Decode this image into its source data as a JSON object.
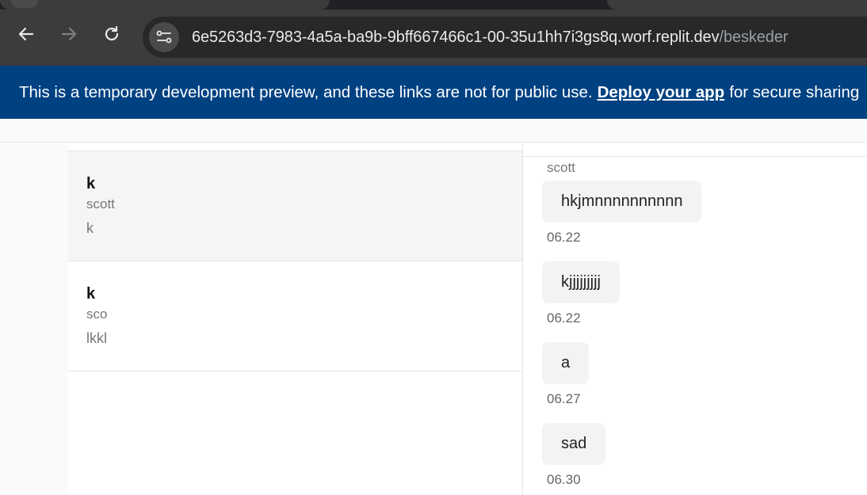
{
  "browser": {
    "url_host": "6e5263d3-7983-4a5a-ba9b-9bff667466c1-00-35u1hh7i3gs8q.worf.replit.dev",
    "url_path": "/beskeder",
    "icons": [
      "back-arrow-icon",
      "forward-arrow-icon",
      "reload-icon",
      "site-settings-icon"
    ]
  },
  "banner": {
    "text_before": "This is a temporary development preview, and these links are not for public use.",
    "link": "Deploy your app",
    "text_after": "for secure sharing"
  },
  "conversations": [
    {
      "title": "k",
      "user": "scott",
      "preview": "k",
      "selected": true
    },
    {
      "title": "k",
      "user": "sco",
      "preview": "lkkl",
      "selected": false
    }
  ],
  "chat": {
    "sender": "scott",
    "messages": [
      {
        "text": "hkjmnnnnnnnnnn",
        "time": "06.22"
      },
      {
        "text": "kjjjjjjjjj",
        "time": "06.22"
      },
      {
        "text": "a",
        "time": "06.27"
      },
      {
        "text": "sad",
        "time": "06.30"
      }
    ]
  },
  "colors": {
    "banner_bg": "#004182",
    "toolbar_bg": "#3c3c3c",
    "bubble_bg": "#f3f3f3"
  }
}
